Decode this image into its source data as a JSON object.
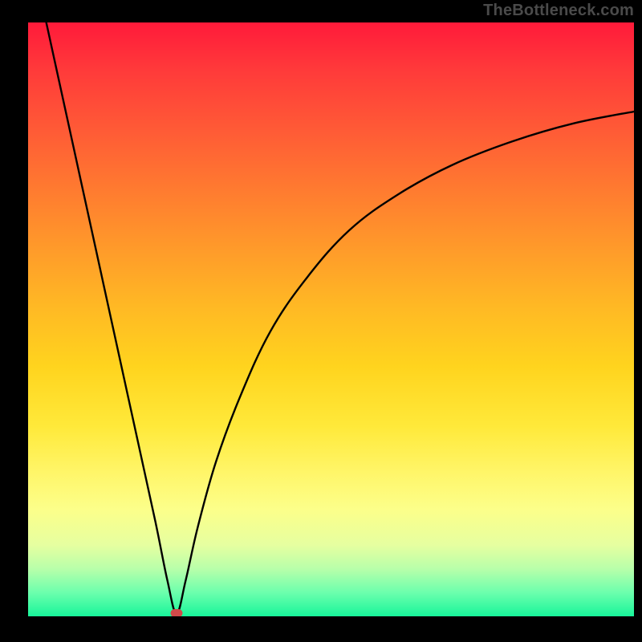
{
  "watermark": "TheBottleneck.com",
  "colors": {
    "frame_bg": "#000000",
    "curve": "#000000",
    "marker": "#d14a4a",
    "gradient_top": "#ff1a3a",
    "gradient_bottom": "#18f59a"
  },
  "chart_data": {
    "type": "line",
    "title": "",
    "xlabel": "",
    "ylabel": "",
    "xlim": [
      0,
      100
    ],
    "ylim": [
      0,
      100
    ],
    "grid": false,
    "legend": "none",
    "notes": "Bottleneck-style curve: steep V with minimum near x≈24.5, y≈0; right branch rises with decreasing slope toward y≈85 at the right edge. Background is a severity gradient (red=high, green=low). Axes have no visible ticks or labels.",
    "series": [
      {
        "name": "bottleneck_curve",
        "x": [
          3,
          6,
          9,
          12,
          15,
          18,
          21,
          23,
          24.5,
          26,
          28,
          31,
          35,
          40,
          46,
          53,
          61,
          70,
          80,
          90,
          100
        ],
        "y": [
          100,
          86,
          72,
          58,
          44,
          30,
          16,
          6,
          0.5,
          6,
          15,
          26,
          37,
          48,
          57,
          65,
          71,
          76,
          80,
          83,
          85
        ]
      }
    ],
    "marker": {
      "x": 24.5,
      "y": 0.5
    }
  }
}
